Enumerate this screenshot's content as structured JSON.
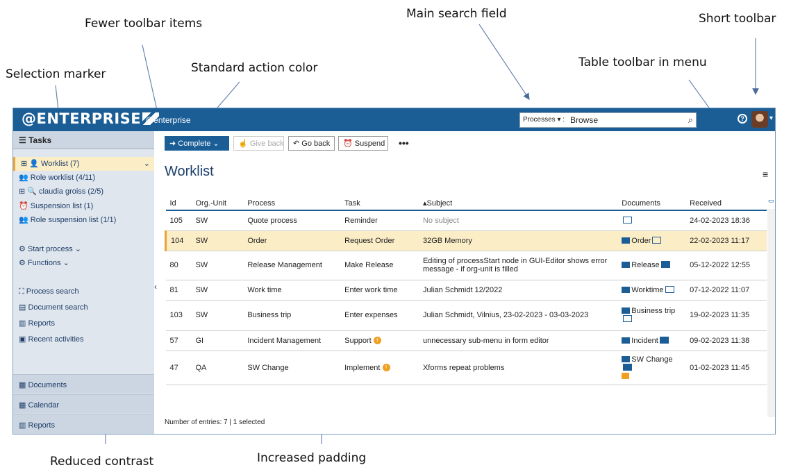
{
  "annotations": {
    "fewer_toolbar": "Fewer toolbar items",
    "main_search": "Main search field",
    "short_toolbar": "Short toolbar",
    "selection_marker": "Selection marker",
    "standard_action": "Standard action color",
    "table_toolbar": "Table toolbar in menu",
    "reduced_contrast": "Reduced contrast",
    "increased_padding": "Increased padding"
  },
  "topbar": {
    "logo": "@ENTERPRISE",
    "tenant": "@enterprise",
    "search_scope": "Processes",
    "search_sep": ":",
    "search_value": "Browse"
  },
  "sidebar": {
    "title": "Tasks",
    "items": [
      {
        "label": "Worklist (7)"
      },
      {
        "label": "Role worklist  (4/11)"
      },
      {
        "label": "claudia groiss (2/5)"
      },
      {
        "label": "Suspension list  (1)"
      },
      {
        "label": "Role suspension list  (1/1)"
      },
      {
        "label": "Start process"
      },
      {
        "label": "Functions"
      },
      {
        "label": "Process search"
      },
      {
        "label": "Document search"
      },
      {
        "label": "Reports"
      },
      {
        "label": "Recent activities"
      }
    ],
    "bottom": [
      {
        "label": "Documents"
      },
      {
        "label": "Calendar"
      },
      {
        "label": "Reports"
      }
    ]
  },
  "toolbar": {
    "complete": "Complete",
    "give_back": "Give back",
    "go_back": "Go back",
    "suspend": "Suspend",
    "more": "•••"
  },
  "page_title": "Worklist",
  "table": {
    "headers": [
      "Id",
      "Org.-Unit",
      "Process",
      "Task",
      "Subject",
      "Documents",
      "Received"
    ],
    "rows": [
      {
        "id": "105",
        "org": "SW",
        "process": "Quote process",
        "task": "Reminder",
        "subject": "No subject",
        "doc": "",
        "received": "24-02-2023 18:36"
      },
      {
        "id": "104",
        "org": "SW",
        "process": "Order",
        "task": "Request Order",
        "subject": "32GB Memory",
        "doc": "Order",
        "received": "22-02-2023 11:17"
      },
      {
        "id": "80",
        "org": "SW",
        "process": "Release Management",
        "task": "Make Release",
        "subject": "Editing of processStart node in GUI-Editor shows error message - if org-unit is filled",
        "doc": "Release",
        "received": "05-12-2022 12:55"
      },
      {
        "id": "81",
        "org": "SW",
        "process": "Work time",
        "task": "Enter work time",
        "subject": "Julian Schmidt 12/2022",
        "doc": "Worktime",
        "received": "07-12-2022 11:07"
      },
      {
        "id": "103",
        "org": "SW",
        "process": "Business trip",
        "task": "Enter expenses",
        "subject": "Julian Schmidt, Vilnius, 23-02-2023 - 03-03-2023",
        "doc": "Business trip",
        "received": "19-02-2023 11:35"
      },
      {
        "id": "57",
        "org": "GI",
        "process": "Incident Management",
        "task": "Support",
        "subject": "unnecessary sub-menu in form editor",
        "doc": "Incident",
        "received": "09-02-2023 11:38"
      },
      {
        "id": "47",
        "org": "QA",
        "process": "SW Change",
        "task": "Implement",
        "subject": "Xforms repeat problems",
        "doc": "SW Change",
        "received": "01-02-2023 11:45"
      }
    ]
  },
  "footer": "Number of entries: 7 | 1 selected"
}
